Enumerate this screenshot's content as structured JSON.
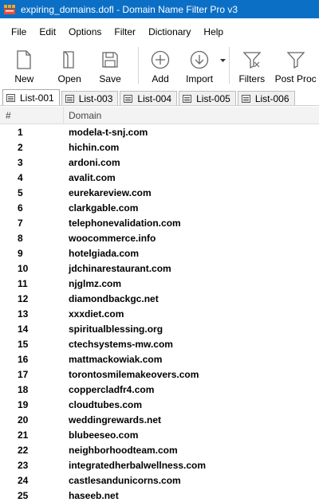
{
  "window": {
    "title": "expiring_domains.dofl - Domain Name Filter Pro v3"
  },
  "menu": [
    "File",
    "Edit",
    "Options",
    "Filter",
    "Dictionary",
    "Help"
  ],
  "toolbar": {
    "new_label": "New",
    "open_label": "Open",
    "save_label": "Save",
    "add_label": "Add",
    "import_label": "Import",
    "filters_label": "Filters",
    "postproc_label": "Post Proc"
  },
  "tabs": [
    "List-001",
    "List-003",
    "List-004",
    "List-005",
    "List-006"
  ],
  "table": {
    "columns": {
      "num": "#",
      "domain": "Domain"
    },
    "rows": [
      {
        "num": "1",
        "domain": "modela-t-snj.com"
      },
      {
        "num": "2",
        "domain": "hichin.com"
      },
      {
        "num": "3",
        "domain": "ardoni.com"
      },
      {
        "num": "4",
        "domain": "avalit.com"
      },
      {
        "num": "5",
        "domain": "eurekareview.com"
      },
      {
        "num": "6",
        "domain": "clarkgable.com"
      },
      {
        "num": "7",
        "domain": "telephonevalidation.com"
      },
      {
        "num": "8",
        "domain": "woocommerce.info"
      },
      {
        "num": "9",
        "domain": "hotelgiada.com"
      },
      {
        "num": "10",
        "domain": "jdchinarestaurant.com"
      },
      {
        "num": "11",
        "domain": "njglmz.com"
      },
      {
        "num": "12",
        "domain": "diamondbackgc.net"
      },
      {
        "num": "13",
        "domain": "xxxdiet.com"
      },
      {
        "num": "14",
        "domain": "spiritualblessing.org"
      },
      {
        "num": "15",
        "domain": "ctechsystems-mw.com"
      },
      {
        "num": "16",
        "domain": "mattmackowiak.com"
      },
      {
        "num": "17",
        "domain": "torontosmilemakeovers.com"
      },
      {
        "num": "18",
        "domain": "coppercladfr4.com"
      },
      {
        "num": "19",
        "domain": "cloudtubes.com"
      },
      {
        "num": "20",
        "domain": "weddingrewards.net"
      },
      {
        "num": "21",
        "domain": "blubeeseo.com"
      },
      {
        "num": "22",
        "domain": "neighborhoodteam.com"
      },
      {
        "num": "23",
        "domain": "integratedherbalwellness.com"
      },
      {
        "num": "24",
        "domain": "castlesandunicorns.com"
      },
      {
        "num": "25",
        "domain": "haseeb.net"
      }
    ]
  }
}
